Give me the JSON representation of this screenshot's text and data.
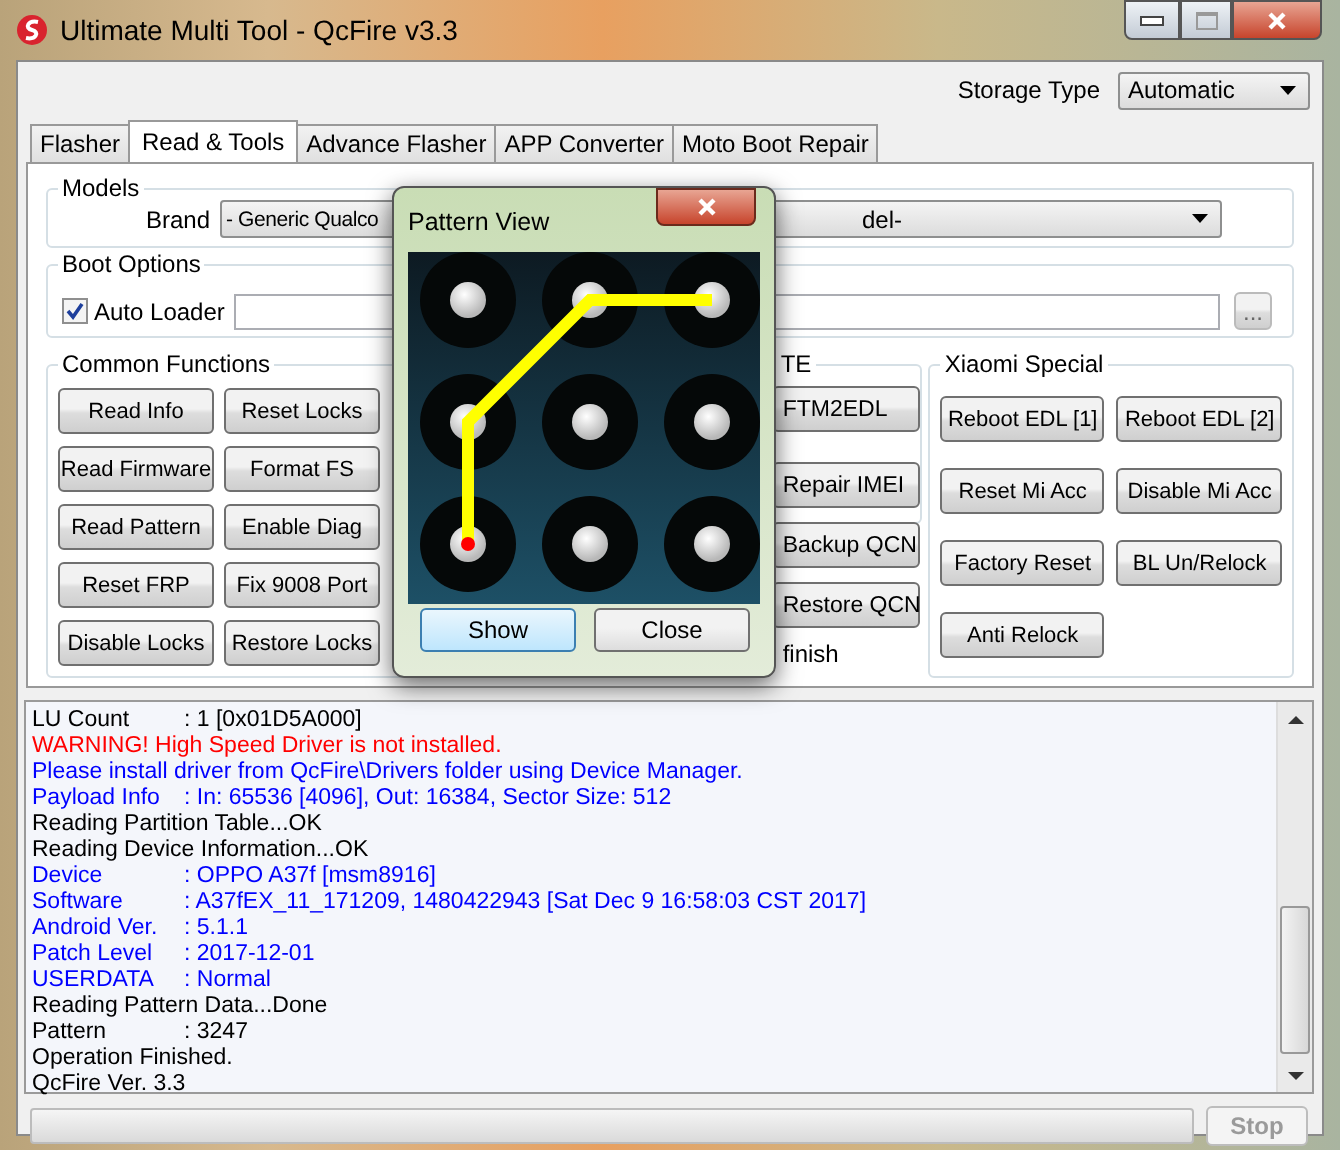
{
  "window": {
    "title": "Ultimate Multi Tool - QcFire v3.3"
  },
  "storage": {
    "label": "Storage Type",
    "value": "Automatic"
  },
  "tabs": [
    {
      "label": "Flasher",
      "selected": false
    },
    {
      "label": "Read & Tools",
      "selected": true
    },
    {
      "label": "Advance Flasher",
      "selected": false
    },
    {
      "label": "APP Converter",
      "selected": false
    },
    {
      "label": "Moto Boot Repair",
      "selected": false
    }
  ],
  "models": {
    "title": "Models",
    "brand_label": "Brand",
    "brand_value": "- Generic Qualco",
    "model_value": "del-"
  },
  "boot_options": {
    "title": "Boot Options",
    "auto_loader": {
      "label": "Auto Loader",
      "checked": true
    },
    "browse": "..."
  },
  "common_functions": {
    "title": "Common Functions",
    "buttons": [
      "Read Info",
      "Reset Locks",
      "Read Firmware",
      "Format FS",
      "Read Pattern",
      "Enable Diag",
      "Reset FRP",
      "Fix 9008 Port",
      "Disable Locks",
      "Restore Locks"
    ]
  },
  "lte": {
    "title": "TE",
    "buttons": [
      "FTM2EDL",
      "Repair IMEI",
      "Backup QCN",
      "Restore QCN"
    ],
    "note": "finish"
  },
  "xiaomi": {
    "title": "Xiaomi Special",
    "buttons": [
      "Reboot EDL [1]",
      "Reboot EDL [2]",
      "Reset Mi Acc",
      "Disable Mi Acc",
      "Factory Reset",
      "BL Un/Relock",
      "Anti Relock"
    ]
  },
  "pattern_view": {
    "title": "Pattern View",
    "buttons": [
      {
        "label": "Show",
        "selected": true
      },
      {
        "label": "Close",
        "selected": false
      }
    ]
  },
  "log": [
    {
      "key": "LU Count",
      "value": ": 1 [0x01D5A000]",
      "color": "#000000"
    },
    {
      "text": "WARNING! High Speed Driver is not installed.",
      "color": "#ff0000"
    },
    {
      "text": "Please install driver from QcFire\\Drivers folder using Device Manager.",
      "color": "#0000ff"
    },
    {
      "key": "Payload Info",
      "value": ": In: 65536 [4096], Out: 16384, Sector Size: 512",
      "color": "#0000ff"
    },
    {
      "text": "Reading Partition Table...OK",
      "color": "#000000"
    },
    {
      "text": "Reading Device Information...OK",
      "color": "#000000"
    },
    {
      "key": "Device",
      "value": ": OPPO A37f [msm8916]",
      "color": "#0000ff"
    },
    {
      "key": "Software",
      "value": ": A37fEX_11_171209, 1480422943 [Sat Dec  9 16:58:03 CST 2017]",
      "color": "#0000ff"
    },
    {
      "key": "Android Ver.",
      "value": ": 5.1.1",
      "color": "#0000ff"
    },
    {
      "key": "Patch Level",
      "value": ": 2017-12-01",
      "color": "#0000ff"
    },
    {
      "key": "USERDATA",
      "value": ": Normal",
      "color": "#0000ff"
    },
    {
      "text": "Reading Pattern Data...Done",
      "color": "#000000"
    },
    {
      "key": "Pattern",
      "value": ": 3247",
      "color": "#000000",
      "kind": "pattern"
    },
    {
      "text": "Operation Finished.",
      "color": "#000000"
    },
    {
      "text": "QcFire Ver. 3.3",
      "color": "#000000"
    }
  ],
  "progress": {
    "level": 0
  },
  "stop_button": {
    "label": "Stop",
    "disabled": true
  }
}
